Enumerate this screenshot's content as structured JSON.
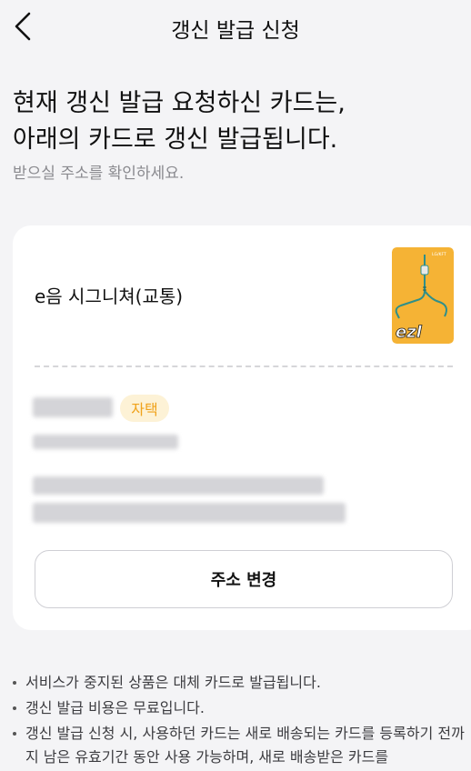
{
  "header": {
    "title": "갱신 발급 신청",
    "back_icon": "chevron-left-icon"
  },
  "headline": {
    "line1": "현재 갱신 발급 요청하신 카드는,",
    "line2": "아래의 카드로 갱신 발급됩니다."
  },
  "subtitle": "받으실 주소를 확인하세요.",
  "card": {
    "name": "e음 시그니쳐(교통)",
    "image_icon": "ezl-transit-card-icon",
    "image_logo_text": "ezl",
    "image_color": "#f5b335"
  },
  "address": {
    "tag": "자택",
    "change_button": "주소 변경"
  },
  "notes": [
    "서비스가 중지된 상품은 대체 카드로 발급됩니다.",
    "갱신 발급 비용은 무료입니다.",
    "갱신 발급 신청 시, 사용하던 카드는 새로 배송되는 카드를 등록하기 전까지 남은 유효기간 동안 사용 가능하며, 새로 배송받은 카드를"
  ],
  "colors": {
    "accent": "#f0a21b",
    "background": "#f4f4f6",
    "card": "#ffffff"
  }
}
